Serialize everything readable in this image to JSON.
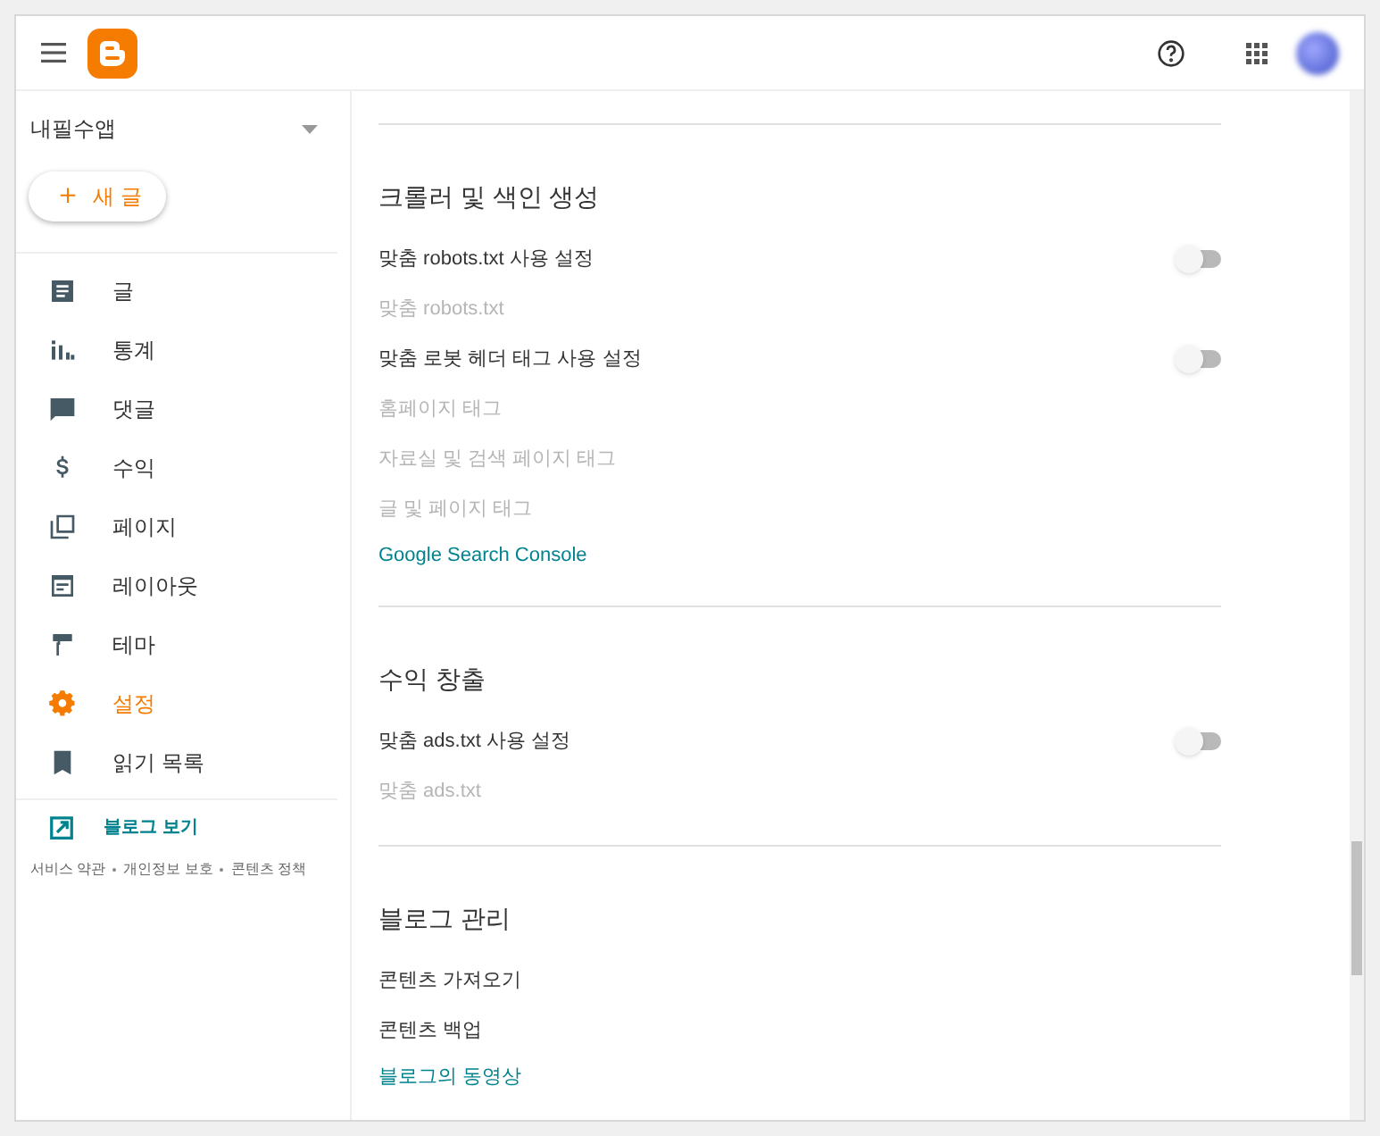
{
  "blog_selector": {
    "name": "내필수앱"
  },
  "new_post_button": {
    "label": "새 글",
    "icon": "＋"
  },
  "sidebar": {
    "items": [
      {
        "label": "글",
        "selected": false
      },
      {
        "label": "통계",
        "selected": false
      },
      {
        "label": "댓글",
        "selected": false
      },
      {
        "label": "수익",
        "selected": false
      },
      {
        "label": "페이지",
        "selected": false
      },
      {
        "label": "레이아웃",
        "selected": false
      },
      {
        "label": "테마",
        "selected": false
      },
      {
        "label": "설정",
        "selected": true
      },
      {
        "label": "읽기 목록",
        "selected": false
      }
    ],
    "view_blog": "블로그 보기",
    "footer_links": [
      "서비스 약관",
      "개인정보 보호",
      "콘텐츠 정책"
    ]
  },
  "sections": [
    {
      "title": "크롤러 및 색인 생성",
      "items": [
        {
          "kind": "toggle",
          "label": "맞춤 robots.txt 사용 설정",
          "on": false
        },
        {
          "kind": "text",
          "label": "맞춤 robots.txt",
          "disabled": true
        },
        {
          "kind": "toggle",
          "label": "맞춤 로봇 헤더 태그 사용 설정",
          "on": false
        },
        {
          "kind": "text",
          "label": "홈페이지 태그",
          "disabled": true
        },
        {
          "kind": "text",
          "label": "자료실 및 검색 페이지 태그",
          "disabled": true
        },
        {
          "kind": "text",
          "label": "글 및 페이지 태그",
          "disabled": true
        },
        {
          "kind": "link",
          "label": "Google Search Console"
        }
      ]
    },
    {
      "title": "수익 창출",
      "items": [
        {
          "kind": "toggle",
          "label": "맞춤 ads.txt 사용 설정",
          "on": false
        },
        {
          "kind": "text",
          "label": "맞춤 ads.txt",
          "disabled": true
        }
      ]
    },
    {
      "title": "블로그 관리",
      "items": [
        {
          "kind": "text",
          "label": "콘텐츠 가져오기",
          "disabled": false
        },
        {
          "kind": "text",
          "label": "콘텐츠 백업",
          "disabled": false
        },
        {
          "kind": "link",
          "label": "블로그의 동영상"
        }
      ]
    }
  ]
}
